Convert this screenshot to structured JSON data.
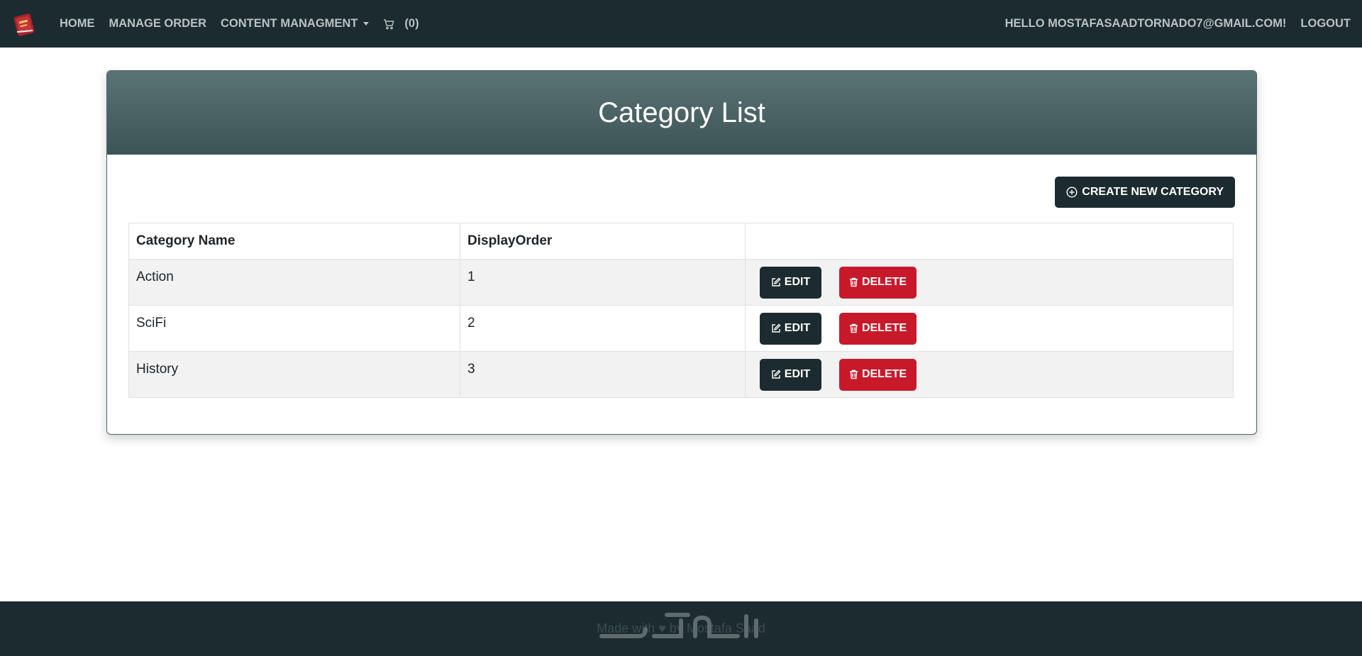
{
  "nav": {
    "home": "HOME",
    "manage_order": "MANAGE ORDER",
    "content": "CONTENT MANAGMENT",
    "cart_count": "(0)",
    "greeting": "HELLO MOSTAFASAADTORNADO7@GMAIL.COM!",
    "logout": "LOGOUT"
  },
  "page": {
    "title": "Category List",
    "create_button": "CREATE NEW CATEGORY"
  },
  "table": {
    "headers": [
      "Category Name",
      "DisplayOrder",
      ""
    ],
    "rows": [
      {
        "name": "Action",
        "order": "1"
      },
      {
        "name": "SciFi",
        "order": "2"
      },
      {
        "name": "History",
        "order": "3"
      }
    ],
    "edit_label": "EDIT",
    "delete_label": "DELETE"
  },
  "footer": {
    "text": "Made with ♥ by Mostafa Saad"
  },
  "icons": {
    "brand": "book-logo-icon",
    "cart": "cart-icon",
    "create": "plus-circle-icon",
    "edit": "edit-icon",
    "delete": "trash-icon"
  },
  "colors": {
    "nav_bg": "#1c2b2f",
    "header_gradient_top": "#5a7375",
    "header_gradient_bottom": "#3d5456",
    "danger": "#c8192b"
  }
}
